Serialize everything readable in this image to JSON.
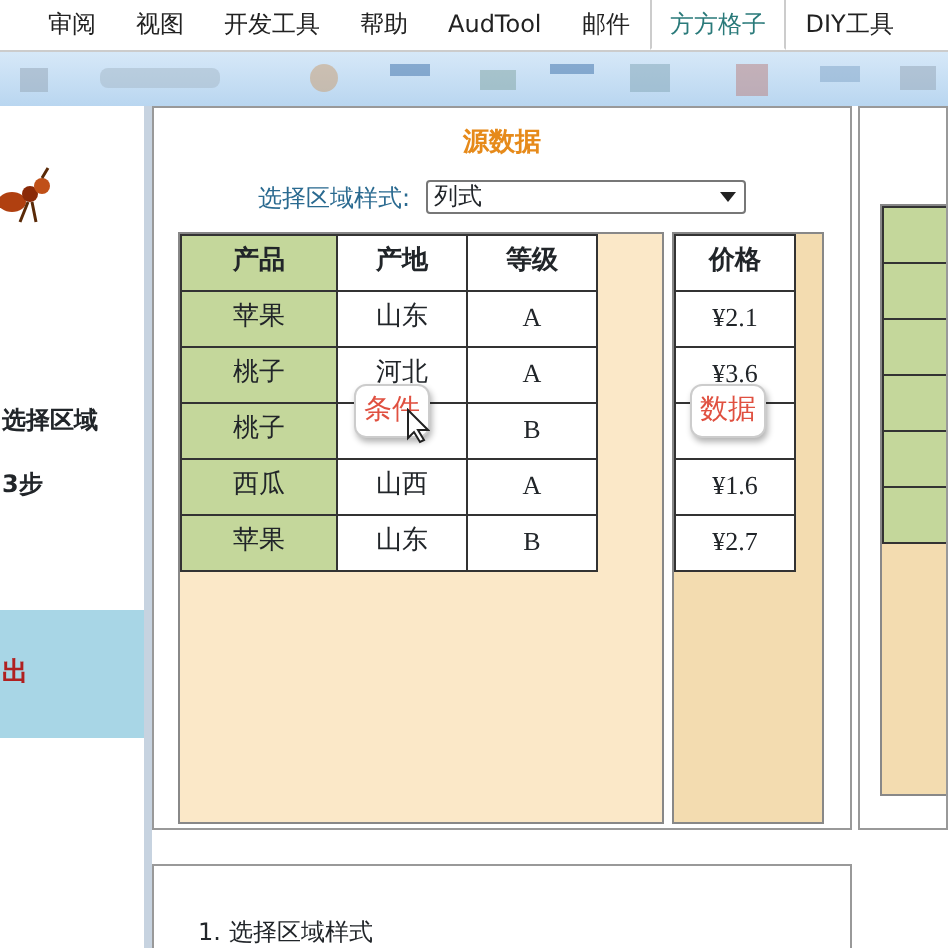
{
  "ribbon_tabs": [
    {
      "label": "审阅",
      "selected": false
    },
    {
      "label": "视图",
      "selected": false
    },
    {
      "label": "开发工具",
      "selected": false
    },
    {
      "label": "帮助",
      "selected": false
    },
    {
      "label": "AudTool",
      "selected": false
    },
    {
      "label": "邮件",
      "selected": false
    },
    {
      "label": "方方格子",
      "selected": true
    },
    {
      "label": "DIY工具",
      "selected": false
    }
  ],
  "left_panel": {
    "texts": [
      "选择区域",
      "3步"
    ],
    "band_text": "出"
  },
  "source_panel": {
    "title": "源数据",
    "style_label": "选择区域样式:",
    "style_value": "列式",
    "condition_table": {
      "columns": [
        "产品",
        "产地",
        "等级"
      ],
      "rows": [
        [
          "苹果",
          "山东",
          "A"
        ],
        [
          "桃子",
          "河北",
          "A"
        ],
        [
          "桃子",
          null,
          "B"
        ],
        [
          "西瓜",
          "山西",
          "A"
        ],
        [
          "苹果",
          "山东",
          "B"
        ]
      ]
    },
    "data_table": {
      "columns": [
        "价格"
      ],
      "rows": [
        [
          "¥2.1"
        ],
        [
          "¥3.6"
        ],
        [
          null
        ],
        [
          "¥1.6"
        ],
        [
          "¥2.7"
        ]
      ]
    },
    "tooltips": [
      {
        "label": "条件"
      },
      {
        "label": "数据"
      }
    ]
  },
  "steps": [
    "1. 选择区域样式"
  ]
}
